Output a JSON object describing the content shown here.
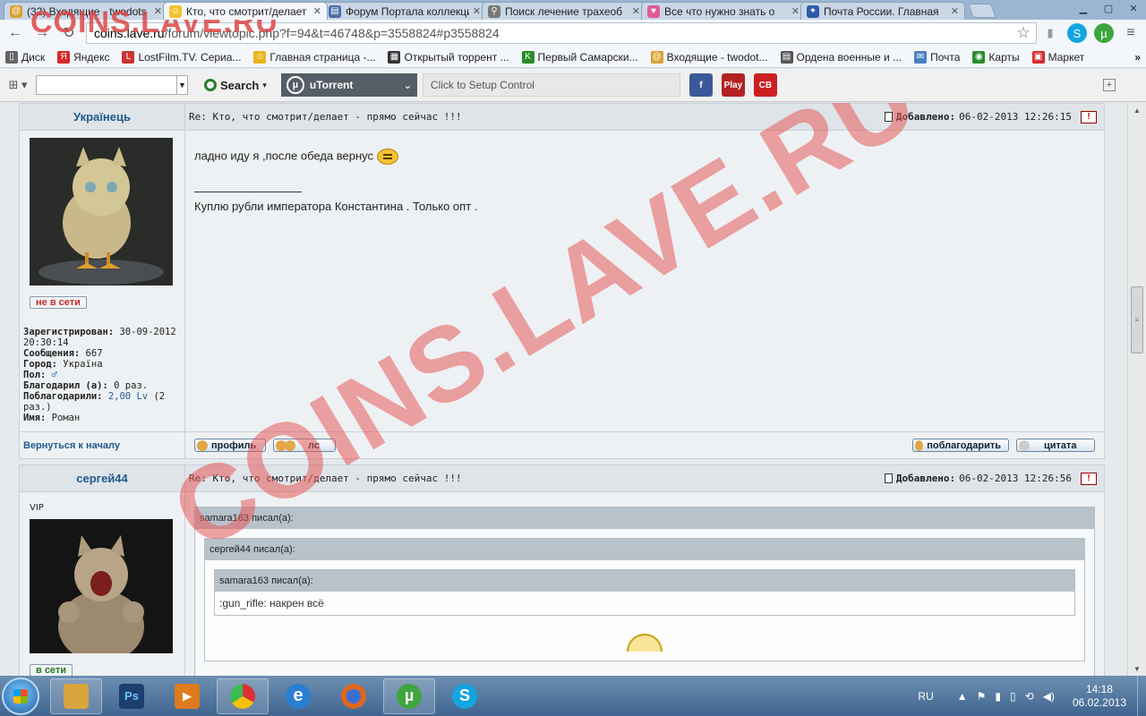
{
  "tabs": [
    {
      "title": "(32) Входящие - twodots",
      "icon_color": "#d8a230",
      "active": false
    },
    {
      "title": "Кто, что смотрит/делает",
      "icon_color": "#f1c232",
      "active": true
    },
    {
      "title": "Форум Портала коллекци",
      "icon_color": "#4b6ea8",
      "active": false
    },
    {
      "title": "Поиск лечение трахеоб",
      "icon_color": "#777777",
      "active": false
    },
    {
      "title": "Все что нужно знать о",
      "icon_color": "#e05a9a",
      "active": false
    },
    {
      "title": "Почта России. Главная",
      "icon_color": "#2b5da8",
      "active": false
    }
  ],
  "omnibox": {
    "host": "coins.lave.ru",
    "path": "/forum/viewtopic.php?f=94&t=46748&p=3558824#p3558824"
  },
  "bookmarks": [
    {
      "label": "Диск",
      "icon_color": "#666666"
    },
    {
      "label": "Яндекс",
      "icon_color": "#d82a2a"
    },
    {
      "label": "LostFilm.TV. Сериа...",
      "icon_color": "#cc3333"
    },
    {
      "label": "Главная страница -...",
      "icon_color": "#e8b71c"
    },
    {
      "label": "Открытый торрент ...",
      "icon_color": "#333333"
    },
    {
      "label": "Первый Самарски...",
      "icon_color": "#2a8c2a"
    },
    {
      "label": "Входящие - twodot...",
      "icon_color": "#d8a230"
    },
    {
      "label": "Ордена военные и ...",
      "icon_color": "#555555"
    },
    {
      "label": "Почта",
      "icon_color": "#4a7fc4"
    },
    {
      "label": "Карты",
      "icon_color": "#2a8c2a"
    },
    {
      "label": "Маркет",
      "icon_color": "#d82a2a"
    }
  ],
  "bookmarks_more": "»",
  "extbar": {
    "search_label": "Search",
    "utorrent_label": "uTorrent",
    "setup_control": "Click to Setup Control",
    "social": [
      {
        "label": "f",
        "color": "#3b5998"
      },
      {
        "label": "Play",
        "color": "#b22222"
      },
      {
        "label": "CB",
        "color": "#cc2020"
      }
    ]
  },
  "watermark": {
    "text": "COINS.LAVE.RU",
    "logo": "COINS.LAVE.RU"
  },
  "posts": [
    {
      "author": "Українець",
      "subject": "Re: Кто, что смотрит/делает - прямо сейчас !!!",
      "added_label": "Добавлено:",
      "date": "06-02-2013 12:26:15",
      "status": "не в сети",
      "info": {
        "registered_label": "Зарегистрирован:",
        "registered": "30-09-2012 20:30:14",
        "messages_label": "Сообщения:",
        "messages": "667",
        "city_label": "Город:",
        "city": "Україна",
        "gender_label": "Пол:",
        "gender": "♂",
        "thanked_label": "Благодарил (а):",
        "thanked": "0 раз.",
        "was_thanked_label": "Поблагодарили:",
        "was_thanked": "2,00 Lv",
        "was_thanked_times": "(2 раз.)",
        "name_label": "Имя:",
        "name": "Роман"
      },
      "message": "ладно иду я ,после обеда вернус",
      "signature": "Куплю рубли императора Константина . Только опт .",
      "back_to_top": "Вернуться к началу",
      "buttons": {
        "profile": "профиль",
        "pm": "лс",
        "thank": "поблагодарить",
        "quote": "цитата"
      }
    },
    {
      "author": "сергей44",
      "subject": "Re: Кто, что смотрит/делает - прямо сейчас !!!",
      "added_label": "Добавлено:",
      "date": "06-02-2013 12:26:56",
      "rank": "VIP",
      "status": "в сети",
      "quotes": {
        "outer_head": "samara163 писал(а):",
        "middle_head": "сергей44 писал(а):",
        "inner_head": "samara163 писал(а):",
        "inner_text": ":gun_rifle: накрен всё"
      }
    }
  ],
  "taskbar": {
    "apps": [
      {
        "name": "explorer",
        "label": "",
        "color": "#d9a53c"
      },
      {
        "name": "photoshop",
        "label": "Ps",
        "color": "#1c3f6e"
      },
      {
        "name": "media",
        "label": "▶",
        "color": "#e07a1e"
      },
      {
        "name": "chrome",
        "label": "",
        "color": "#2f9e44"
      },
      {
        "name": "ie",
        "label": "e",
        "color": "#2a7fd4"
      },
      {
        "name": "firefox",
        "label": "",
        "color": "#e0661e"
      },
      {
        "name": "utorrent",
        "label": "µ",
        "color": "#3ea63e"
      },
      {
        "name": "skype",
        "label": "S",
        "color": "#12a5e3"
      }
    ],
    "lang": "RU",
    "time": "14:18",
    "date": "06.02.2013"
  }
}
